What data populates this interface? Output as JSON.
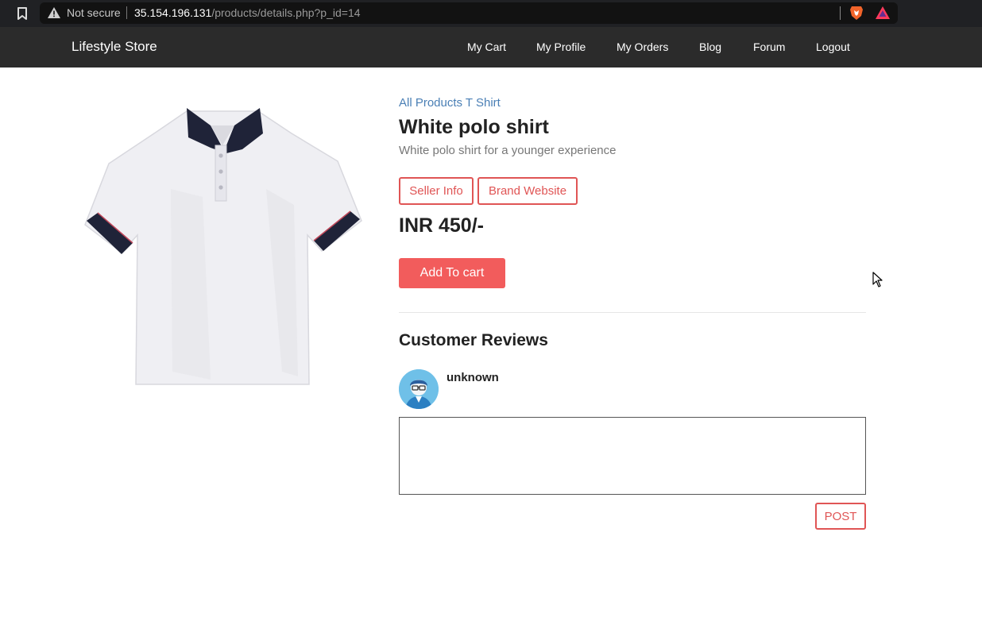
{
  "browser": {
    "security_label": "Not secure",
    "url_host": "35.154.196.131",
    "url_path": "/products/details.php?p_id=14"
  },
  "navbar": {
    "brand": "Lifestyle Store",
    "links": [
      "My Cart",
      "My Profile",
      "My Orders",
      "Blog",
      "Forum",
      "Logout"
    ]
  },
  "product": {
    "breadcrumb": "All Products T Shirt",
    "title": "White polo shirt",
    "description": "White polo shirt for a younger experience",
    "seller_info_label": "Seller Info",
    "brand_website_label": "Brand Website",
    "price": "INR 450/-",
    "add_to_cart_label": "Add To cart",
    "image_icon": "polo-shirt-image"
  },
  "reviews": {
    "heading": "Customer Reviews",
    "reviewer_name": "unknown",
    "review_value": "",
    "post_label": "POST"
  },
  "colors": {
    "accent": "#f25c5c",
    "link": "#4a7fb5",
    "navbar": "#2b2b2b"
  }
}
